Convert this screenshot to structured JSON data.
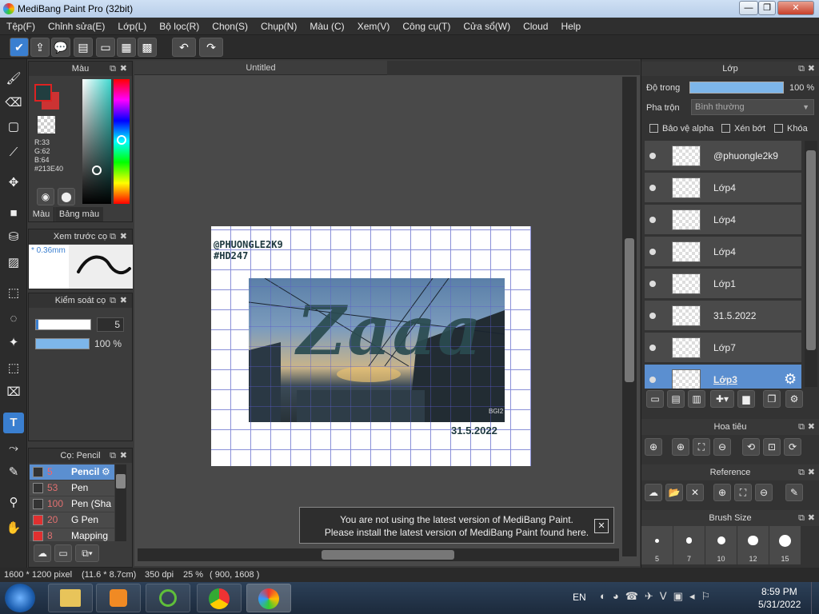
{
  "window": {
    "title": "MediBang Paint Pro (32bit)",
    "min": "—",
    "max": "❐",
    "close": "✕"
  },
  "menu": [
    "Tệp(F)",
    "Chỉnh sửa(E)",
    "Lớp(L)",
    "Bộ lọc(R)",
    "Chọn(S)",
    "Chụp(N)",
    "Màu (C)",
    "Xem(V)",
    "Công cụ(T)",
    "Cửa sổ(W)",
    "Cloud",
    "Help"
  ],
  "toolbar_icons": [
    "check-icon",
    "upload-icon",
    "speech-icon",
    "comment-icon",
    "page-icon",
    "grid-icon",
    "settings-grid-icon",
    "undo-icon",
    "redo-icon"
  ],
  "color_panel": {
    "title": "Màu",
    "r": "R:33",
    "g": "G:62",
    "b": "B:64",
    "hex": "#213E40",
    "tab_color": "Màu",
    "tab_palette": "Bảng màu",
    "fg": "#213E40",
    "bg_frame": "#cc2222"
  },
  "preview_panel": {
    "title": "Xem trước cọ",
    "size": "* 0.36mm"
  },
  "brush_control": {
    "title": "Kiểm soát cọ",
    "size_value": "5",
    "opacity_value": "100 %"
  },
  "brush_panel": {
    "title": "Cọ: Pencil",
    "items": [
      {
        "size": "5",
        "name": "Pencil",
        "color": "#333333",
        "active": true
      },
      {
        "size": "53",
        "name": "Pen",
        "color": "#333333"
      },
      {
        "size": "100",
        "name": "Pen (Sha",
        "color": "#333333"
      },
      {
        "size": "20",
        "name": "G Pen",
        "color": "#e03030"
      },
      {
        "size": "8",
        "name": "Mapping",
        "color": "#e03030"
      }
    ]
  },
  "canvas": {
    "tab": "Untitled",
    "watermark_line1": "@PHUONGLE2K9",
    "watermark_line2": "#HD247",
    "lettering": "Zaaa",
    "photo_signature": "BGI2",
    "date": "31.5.2022"
  },
  "notice": {
    "line1": "You are not using the latest version of MediBang Paint.",
    "line2": "Please install the latest version of MediBang Paint found here.",
    "close": "✕"
  },
  "layers_panel": {
    "title": "Lớp",
    "opacity_label": "Độ trong",
    "opacity_value": "100 %",
    "opacity_fraction": 1.0,
    "blend_label": "Pha trộn",
    "blend_value": "Bình thường",
    "protect_alpha": "Bảo vệ alpha",
    "clipping": "Xén bớt",
    "lock": "Khóa",
    "layers": [
      {
        "name": "@phuongle2k9",
        "active": false
      },
      {
        "name": "Lớp4",
        "active": false
      },
      {
        "name": "Lớp4",
        "active": false
      },
      {
        "name": "Lớp4",
        "active": false
      },
      {
        "name": "Lớp1",
        "active": false
      },
      {
        "name": "31.5.2022",
        "active": false
      },
      {
        "name": "Lớp7",
        "active": false
      },
      {
        "name": "Lớp3",
        "active": true
      }
    ]
  },
  "navigator": {
    "title": "Hoa tiêu"
  },
  "reference": {
    "title": "Reference"
  },
  "brush_size": {
    "title": "Brush Size",
    "sizes": [
      "5",
      "7",
      "10",
      "12",
      "15"
    ]
  },
  "status": {
    "dims": "1600 * 1200 pixel",
    "physical": "(11.6 * 8.7cm)",
    "dpi": "350 dpi",
    "zoom": "25 %",
    "coords": "( 900, 1608 )"
  },
  "taskbar": {
    "lang": "EN",
    "time": "8:59 PM",
    "date": "5/31/2022"
  }
}
